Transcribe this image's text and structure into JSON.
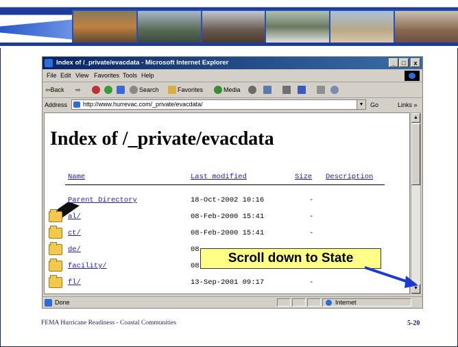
{
  "window": {
    "title": "Index of /_private/evacdata - Microsoft Internet Explorer",
    "min_label": "_",
    "max_label": "□",
    "close_label": "x"
  },
  "menu": [
    "File",
    "Edit",
    "View",
    "Favorites",
    "Tools",
    "Help"
  ],
  "toolbar": {
    "back": "⇦Back",
    "forward": "⇨",
    "search": "Search",
    "favorites": "Favorites",
    "media": "Media"
  },
  "address": {
    "label": "Address",
    "value": "http://www.hurrevac.com/_private/evacdata/",
    "go": "Go",
    "links": "Links »"
  },
  "page": {
    "heading": "Index of /_private/evacdata",
    "columns": [
      "Name",
      "Last modified",
      "Size",
      "Description"
    ],
    "entries": [
      {
        "icon": "parent-directory-icon",
        "name": "Parent Directory",
        "modified": "18-Oct-2002 10:16",
        "size": "-"
      },
      {
        "icon": "folder-icon",
        "name": "al/",
        "modified": "08-Feb-2000 15:41",
        "size": "-"
      },
      {
        "icon": "folder-icon",
        "name": "ct/",
        "modified": "08-Feb-2000 15:41",
        "size": "-"
      },
      {
        "icon": "folder-icon",
        "name": "de/",
        "modified": "08",
        "size": ""
      },
      {
        "icon": "folder-icon",
        "name": "facility/",
        "modified": "08",
        "size": ""
      },
      {
        "icon": "folder-icon",
        "name": "fl/",
        "modified": "13-Sep-2001 09:17",
        "size": "-"
      }
    ]
  },
  "status": {
    "text": "Done",
    "zone": "Internet"
  },
  "callout": "Scroll down to State",
  "footer": {
    "text": "FEMA Hurricane Readiness - Coastal Communities",
    "slide_number": "5-20"
  },
  "colors": {
    "banner_blue": "#1e3a9a",
    "title_bar": "#0a246a",
    "link_blue": "#1a1ab0",
    "callout_fill": "#ffff88",
    "arrow_blue": "#1a3ad6"
  }
}
